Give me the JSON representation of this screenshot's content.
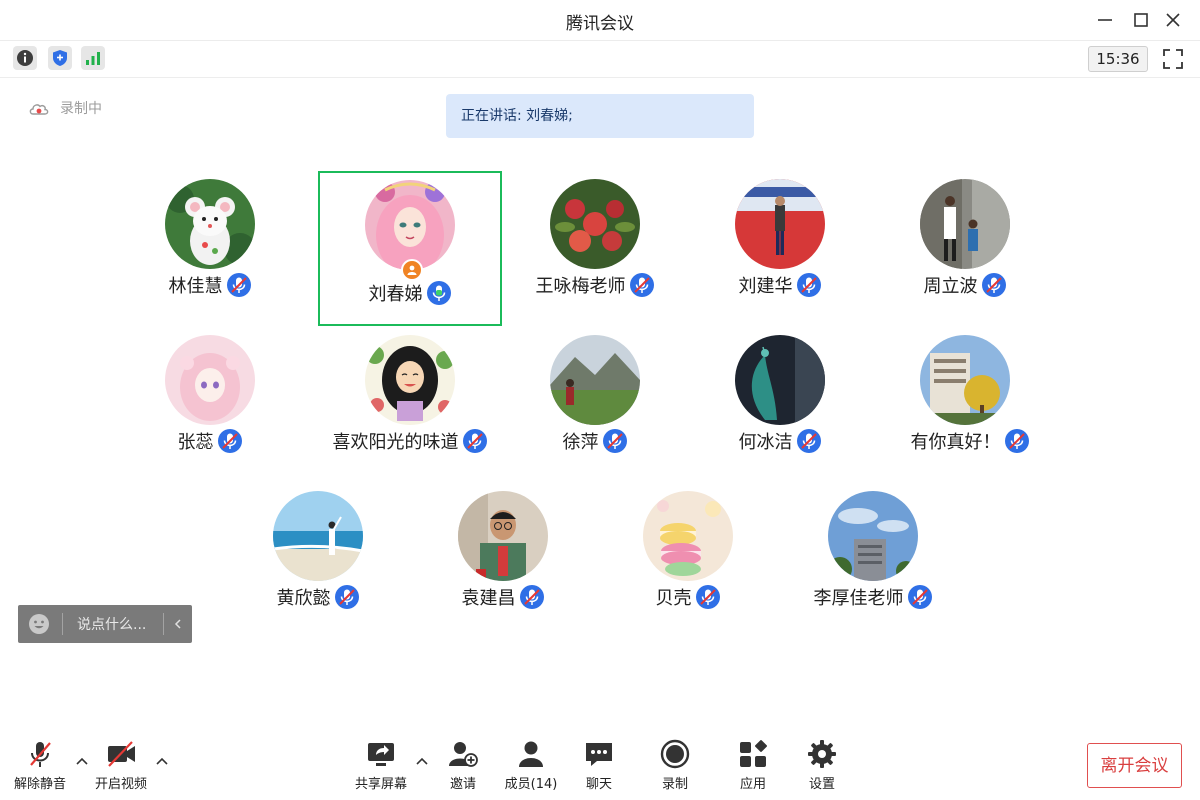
{
  "window": {
    "title": "腾讯会议"
  },
  "top_bar": {
    "clock": "15:36"
  },
  "status": {
    "recording_label": "录制中",
    "speaking_text": "正在讲话: 刘春娣;"
  },
  "participants": [
    {
      "name": "林佳慧",
      "mic": "muted",
      "avatar": "mouse"
    },
    {
      "name": "刘春娣",
      "mic": "active",
      "avatar": "girl-pink",
      "speaking": true,
      "host": true
    },
    {
      "name": "王咏梅老师",
      "mic": "muted",
      "avatar": "fruit"
    },
    {
      "name": "刘建华",
      "mic": "muted",
      "avatar": "man-stage"
    },
    {
      "name": "周立波",
      "mic": "muted",
      "avatar": "kids-wall"
    },
    {
      "name": "张蕊",
      "mic": "muted",
      "avatar": "anime"
    },
    {
      "name": "喜欢阳光的味道",
      "mic": "muted",
      "avatar": "cartoon-lady"
    },
    {
      "name": "徐萍",
      "mic": "muted",
      "avatar": "mountain"
    },
    {
      "name": "何冰洁",
      "mic": "muted",
      "avatar": "peacock"
    },
    {
      "name": "有你真好！",
      "mic": "muted",
      "avatar": "building-tree"
    },
    {
      "name": "黄欣懿",
      "mic": "muted",
      "avatar": "beach"
    },
    {
      "name": "袁建昌",
      "mic": "muted",
      "avatar": "man-glasses"
    },
    {
      "name": "贝壳",
      "mic": "muted",
      "avatar": "macarons"
    },
    {
      "name": "李厚佳老师",
      "mic": "muted",
      "avatar": "sky-building"
    }
  ],
  "chat": {
    "placeholder": "说点什么..."
  },
  "bottom_bar": {
    "unmute": "解除静音",
    "start_video": "开启视频",
    "share_screen": "共享屏幕",
    "invite": "邀请",
    "members": "成员(14)",
    "chat": "聊天",
    "record": "录制",
    "apps": "应用",
    "settings": "设置",
    "leave": "离开会议"
  },
  "colors": {
    "speaking_border": "#1bbb5a",
    "mic_blue": "#2f6fe6",
    "leave_red": "#d93f3f",
    "speaking_bg": "#dbe8fb"
  }
}
